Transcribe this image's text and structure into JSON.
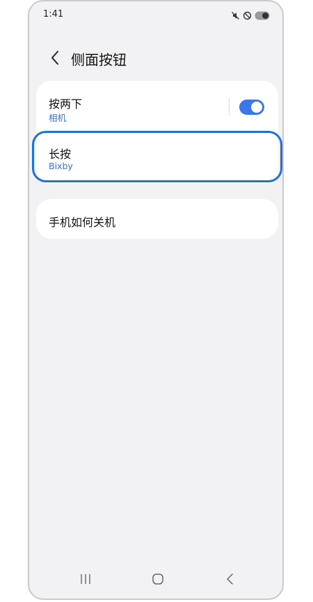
{
  "status_bar": {
    "time": "1:41",
    "icons": [
      "mute-icon",
      "do-not-disturb-icon",
      "battery-icon"
    ]
  },
  "header": {
    "title": "侧面按钮",
    "back_icon": "chevron-left-icon"
  },
  "settings": {
    "double_press": {
      "title": "按两下",
      "subtitle": "相机",
      "toggle_on": true
    },
    "press_and_hold": {
      "title": "长按",
      "subtitle": "Bixby",
      "highlighted": true
    },
    "power_off": {
      "title": "手机如何关机"
    }
  },
  "colors": {
    "accent": "#3a77ea",
    "highlight": "#1f6fe0",
    "subtitle": "#3c6fcf",
    "background": "#f2f2f4"
  },
  "nav_bar": {
    "icons": [
      "recents-icon",
      "home-icon",
      "back-icon"
    ]
  }
}
